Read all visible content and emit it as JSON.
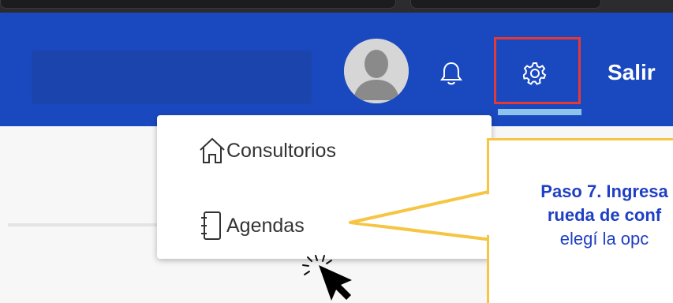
{
  "header": {
    "logout_label": "Salir",
    "accent_color": "#1a49bf",
    "highlight_color": "#e53935"
  },
  "icons": {
    "avatar": "user-avatar-icon",
    "notifications": "bell-icon",
    "settings": "gear-icon",
    "menu_item_1": "house-icon",
    "menu_item_2": "notebook-icon",
    "pointer": "cursor-arrow-icon"
  },
  "settings_menu": {
    "items": [
      {
        "label": "Consultorios",
        "icon": "house-icon"
      },
      {
        "label": "Agendas",
        "icon": "notebook-icon"
      }
    ]
  },
  "callout": {
    "line1": "Paso 7. Ingresa",
    "line2": "rueda de conf",
    "line3": "elegí la opc",
    "border_color": "#f5c543",
    "text_color": "#1f3fc4"
  }
}
